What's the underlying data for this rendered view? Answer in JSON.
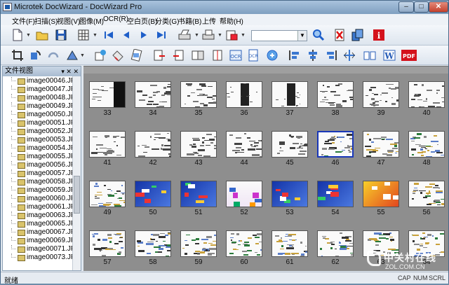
{
  "window": {
    "title": "Microtek DocWizard - DocWizard Pro"
  },
  "menu": [
    "文件(F)",
    "扫描(S)",
    "视图(V)",
    "图像(M)",
    "OCR(R)",
    "空白页(B)",
    "分类(G)",
    "书籍(B)",
    "上传",
    "帮助(H)"
  ],
  "toolbar1": {
    "zoom_value": ""
  },
  "toolbar1_icons": [
    "new-document-icon",
    "open-folder-icon",
    "save-icon",
    "thumbnail-view-icon",
    "first-page-icon",
    "previous-page-icon",
    "next-page-icon",
    "last-page-icon",
    "scan-icon",
    "batch-scan-icon",
    "scan-setting-icon",
    "zoom-search-icon",
    "delete-page-icon",
    "copy-pages-icon",
    "info-icon"
  ],
  "toolbar2_icons": [
    "crop-icon",
    "rotate-icon",
    "undo-icon",
    "select-icon",
    "fill-icon",
    "eraser-icon",
    "stamp-icon",
    "page-left-icon",
    "page-right-icon",
    "page-both-icon",
    "ocr-icon",
    "ocr-doc-icon",
    "ocr-run-icon",
    "align-left-icon",
    "align-center-icon",
    "align-right-icon",
    "split-icon",
    "book-icon",
    "word-icon",
    "pdf-icon"
  ],
  "sidebar": {
    "title": "文件视图",
    "controls": "▾ ✕ ✕",
    "files": [
      "image00046.JPG",
      "image00047.JPG",
      "image00048.JPG",
      "image00049.JPG",
      "image00050.JPG",
      "image00051.JPG",
      "image00052.JPG",
      "image00053.JPG",
      "image00054.JPG",
      "image00055.JPG",
      "image00056.JPG",
      "image00057.JPG",
      "image00058.JPG",
      "image00059.JPG",
      "image00060.JPG",
      "image00061.JPG",
      "image00063.JPG",
      "image00065.JPG",
      "image00067.JPG",
      "image00069.JPG",
      "image00071.JPG",
      "image00073.JPG"
    ]
  },
  "thumbnails": {
    "rows": [
      [
        "33",
        "34",
        "35",
        "36",
        "37",
        "38",
        "39",
        "40"
      ],
      [
        "41",
        "42",
        "43",
        "44",
        "45",
        "46",
        "47",
        "48"
      ],
      [
        "49",
        "50",
        "51",
        "52",
        "53",
        "54",
        "55",
        "56"
      ],
      [
        "57",
        "58",
        "59",
        "60",
        "61",
        "62",
        "63",
        "64"
      ]
    ],
    "selected": "46"
  },
  "status": {
    "text": "就绪",
    "indicators": [
      "CAP",
      "NUM",
      "SCRL"
    ]
  },
  "watermark": {
    "main": "中关村在线",
    "sub": "ZOL.COM.CN"
  }
}
